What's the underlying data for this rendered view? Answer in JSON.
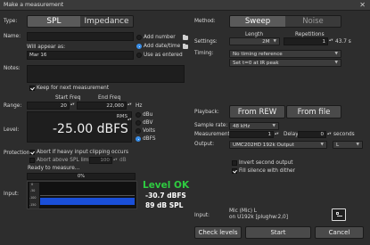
{
  "window": {
    "title": "Make a measurement",
    "close": "✕"
  },
  "type": {
    "label": "Type:",
    "spl": "SPL",
    "impedance": "Impedance"
  },
  "method": {
    "label": "Method:",
    "sweep": "Sweep",
    "noise": "Noise"
  },
  "name": {
    "label": "Name:",
    "value": "",
    "add_number": "Add number",
    "add_datetime": "Add date/time",
    "use_as_entered": "Use as entered",
    "will_appear_label": "Will appear as:",
    "will_appear_value": "Mar 16"
  },
  "settings": {
    "label": "Settings:",
    "length_header": "Length",
    "reps_header": "Repetitions",
    "length": "2M",
    "reps": "1",
    "duration": "43.7 s"
  },
  "timing": {
    "label": "Timing:",
    "ref": "No timing reference",
    "offset": "Set t=0 at IR peak"
  },
  "notes": {
    "label": "Notes:",
    "keep": "Keep for next measurement"
  },
  "range": {
    "label": "Range:",
    "start_hdr": "Start Freq",
    "end_hdr": "End Freq",
    "start": "20",
    "end": "22,000",
    "unit": "Hz"
  },
  "level": {
    "label": "Level:",
    "rms": "RMS",
    "value": "-25.00 dBFS",
    "units": [
      "dBu",
      "dBV",
      "Volts",
      "dBFS"
    ],
    "selected": "dBFS"
  },
  "playback": {
    "label": "Playback:",
    "from_rew": "From REW",
    "from_file": "From file"
  },
  "sample_rate": {
    "label": "Sample rate:",
    "value": "48 kHz"
  },
  "measurements": {
    "label": "Measurements:",
    "count": "1",
    "delay_label": "Delay",
    "delay": "0",
    "delay_unit": "seconds"
  },
  "output": {
    "label": "Output:",
    "device": "UMC202HD 192k Output",
    "channel": "L",
    "invert": "Invert second output",
    "fill_silence": "Fill silence with dither"
  },
  "protection": {
    "label": "Protection:",
    "abort_clip": "Abort if heavy input clipping occurs",
    "abort_spl": "Abort above SPL limit",
    "spl_limit": "100",
    "spl_unit": "dB"
  },
  "status": {
    "text": "Ready to measure...",
    "progress_pct": 0,
    "progress_text": "0%"
  },
  "input_meter": {
    "label": "Input:",
    "ticks": [
      "0",
      "-50",
      "-100",
      "-150"
    ],
    "status": "Level OK",
    "dbfs": "-30.7 dBFS",
    "spl": "89 dB SPL",
    "level_fraction": 0.3
  },
  "input_device": {
    "label": "Input:",
    "line1": "Mic (Mic) L",
    "line2": "on U192k [plughw:2,0]"
  },
  "buttons": {
    "check_levels": "Check levels",
    "start": "Start",
    "cancel": "Cancel"
  },
  "colors": {
    "accent": "#3b8fe8",
    "ok_green": "#2ecc40",
    "meter_blue": "#1a4fd8"
  }
}
